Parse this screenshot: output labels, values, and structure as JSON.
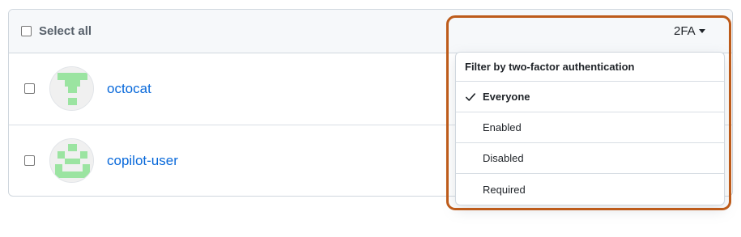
{
  "header": {
    "select_all_label": "Select all",
    "filter_label": "2FA"
  },
  "members": [
    {
      "username": "octocat",
      "avatar": "green-pixel-identicon"
    },
    {
      "username": "copilot-user",
      "avatar": "green-pixel-identicon"
    }
  ],
  "filter_menu": {
    "title": "Filter by two-factor authentication",
    "items": [
      {
        "label": "Everyone",
        "selected": true
      },
      {
        "label": "Enabled",
        "selected": false
      },
      {
        "label": "Disabled",
        "selected": false
      },
      {
        "label": "Required",
        "selected": false
      }
    ]
  },
  "colors": {
    "highlight": "#bd5b1a",
    "link": "#0969da",
    "identicon": "#9be4a1"
  },
  "icons": {
    "caret": "triangle-down-icon",
    "check": "check-icon"
  }
}
